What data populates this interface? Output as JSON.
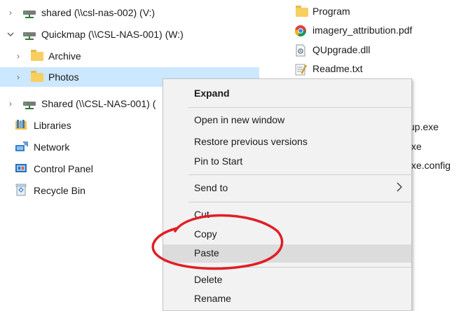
{
  "nav": {
    "shared_002": "shared (\\\\csl-nas-002) (V:)",
    "quickmap_001": "Quickmap (\\\\CSL-NAS-001) (W:)",
    "archive": "Archive",
    "photos": "Photos",
    "shared_001_partial": "Shared (\\\\CSL-NAS-001) (",
    "libraries": "Libraries",
    "network": "Network",
    "control_panel": "Control Panel",
    "recycle_bin": "Recycle Bin"
  },
  "files": {
    "program": "Program",
    "imagery_attribution": "imagery_attribution.pdf",
    "qupgrade": "QUpgrade.dll",
    "readme": "Readme.txt",
    "partial_setup": "up.exe",
    "partial_exe": "xe",
    "partial_config": "xe.config"
  },
  "context_menu": {
    "expand": "Expand",
    "open_new_window": "Open in new window",
    "restore_previous": "Restore previous versions",
    "pin_to_start": "Pin to Start",
    "send_to": "Send to",
    "cut": "Cut",
    "copy": "Copy",
    "paste": "Paste",
    "delete": "Delete",
    "rename": "Rename"
  },
  "colors": {
    "selection": "#cce8ff",
    "menu_background": "#f2f2f2",
    "menu_hover": "#dcdcdc",
    "annotation": "#e01f26",
    "folder": "#f7cf60"
  },
  "icons": {
    "chevron_collapsed": "chevron-right-icon",
    "chevron_expanded": "chevron-down-icon",
    "network_drive": "network-drive-icon",
    "folder": "folder-icon",
    "libraries": "libraries-icon",
    "network": "network-icon",
    "control_panel": "control-panel-icon",
    "recycle_bin": "recycle-bin-icon",
    "chrome_pdf": "chrome-icon",
    "dll": "dll-file-icon",
    "text_file": "text-file-icon",
    "submenu": "chevron-right-icon"
  }
}
